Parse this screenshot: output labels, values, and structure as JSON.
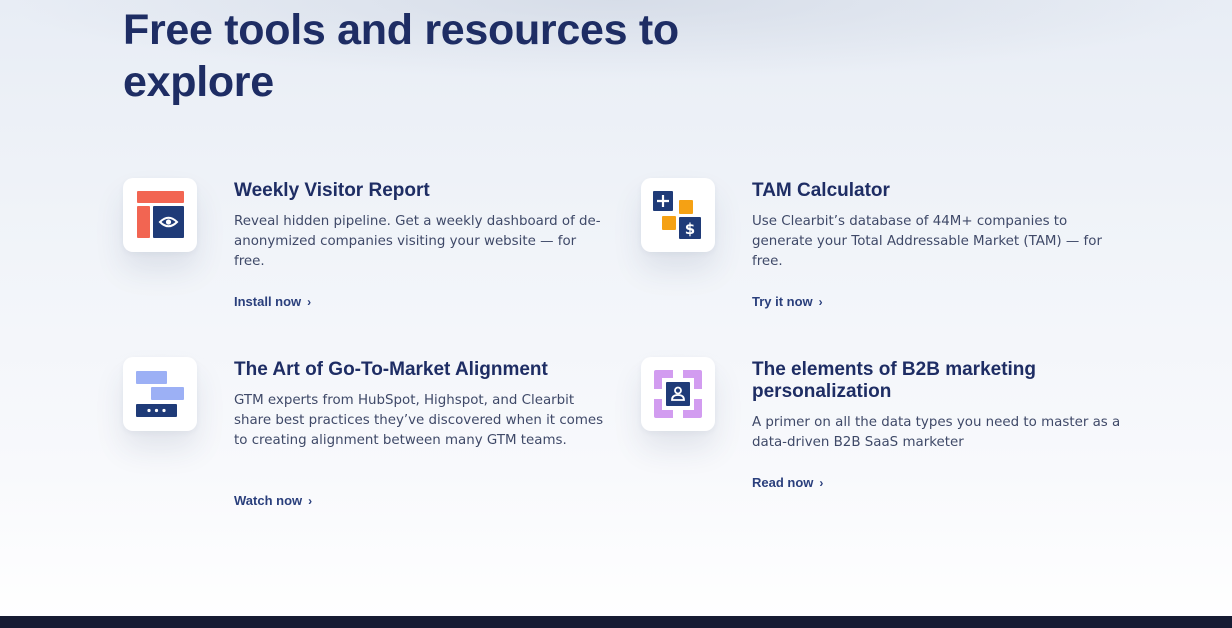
{
  "section": {
    "title": "Free tools and resources to explore"
  },
  "cards": [
    {
      "title": "Weekly Visitor Report",
      "description": "Reveal hidden pipeline. Get a weekly dashboard of de-anonymized companies visiting your website — for free.",
      "link": "Install now",
      "icon": "dashboard-eye-icon"
    },
    {
      "title": "TAM Calculator",
      "description": "Use Clearbit’s database of 44M+ companies to generate your Total Addressable Market (TAM) — for free.",
      "link": "Try it now",
      "icon": "calculator-icon"
    },
    {
      "title": "The Art of Go-To-Market Alignment",
      "description": "GTM experts from HubSpot, Highspot, and Clearbit share best practices they’ve discovered when it comes to creating alignment between many GTM teams.",
      "link": "Watch now",
      "icon": "alignment-bars-icon"
    },
    {
      "title": "The elements of B2B marketing personalization",
      "description": "A primer on all the data types you need to master as a data-driven B2B SaaS marketer",
      "link": "Read now",
      "icon": "personalization-profile-icon"
    }
  ],
  "colors": {
    "heading": "#1e2d64",
    "body_text": "#3f4968",
    "link": "#2a3f7c",
    "coral": "#f26552",
    "navy": "#1f3b78",
    "orange": "#f5a114",
    "periwinkle": "#9cb0f5",
    "lavender": "#d29cf0",
    "footer": "#161b33"
  }
}
